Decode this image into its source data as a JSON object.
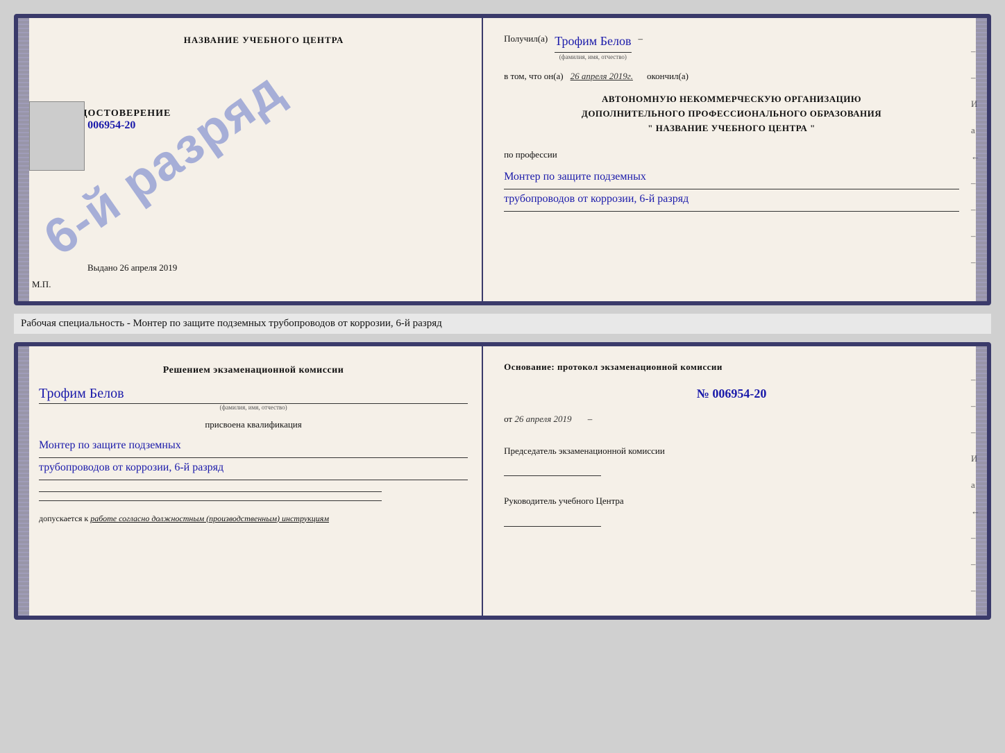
{
  "top_doc": {
    "left": {
      "center_title": "НАЗВАНИЕ УЧЕБНОГО ЦЕНТРА",
      "stamp_text": "6-й разряд",
      "udostoverenie_label": "УДОСТОВЕРЕНИЕ",
      "udost_number": "№ 006954-20",
      "vydano_prefix": "Выдано",
      "vydano_date": "26 апреля 2019",
      "mp_label": "М.П."
    },
    "right": {
      "poluchil_label": "Получил(а)",
      "handwritten_name": "Трофим Белов",
      "name_hint": "(фамилия, имя, отчество)",
      "dash1": "–",
      "vtom_label": "в том, что он(а)",
      "date_handwritten": "26 апреля 2019г.",
      "okoncil_label": "окончил(а)",
      "dash2": "–",
      "org_line1": "АВТОНОМНУЮ НЕКОММЕРЧЕСКУЮ ОРГАНИЗАЦИЮ",
      "org_line2": "ДОПОЛНИТЕЛЬНОГО ПРОФЕССИОНАЛЬНОГО ОБРАЗОВАНИЯ",
      "org_quote": "\"   НАЗВАНИЕ УЧЕБНОГО ЦЕНТРА   \"",
      "dash3": "–",
      "i_label": "И",
      "a_label": "а",
      "arrow_label": "←",
      "po_professii": "по профессии",
      "profession_line1": "Монтер по защите подземных",
      "profession_line2": "трубопроводов от коррозии, 6-й разряд",
      "dash4": "–"
    }
  },
  "middle": {
    "text": "Рабочая специальность - Монтер по защите подземных трубопроводов от коррозии, 6-й разряд"
  },
  "bottom_doc": {
    "left": {
      "title": "Решением  экзаменационной  комиссии",
      "handwritten_name": "Трофим Белов",
      "name_hint": "(фамилия, имя, отчество)",
      "prisvoena": "присвоена квалификация",
      "profession_line1": "Монтер по защите подземных",
      "profession_line2": "трубопроводов от коррозии, 6-й разряд",
      "dopuskaetsya_prefix": "допускается к",
      "dopuskaetsya_italic": "работе согласно должностным (производственным) инструкциям"
    },
    "right": {
      "title": "Основание: протокол  экзаменационной  комиссии",
      "number": "№  006954-20",
      "ot_prefix": "от",
      "ot_date": "26 апреля 2019",
      "dash1": "–",
      "dash2": "–",
      "dash3": "–",
      "i_label": "И",
      "a_label": "а",
      "arrow_label": "←",
      "predsedatel": "Председатель экзаменационной комиссии",
      "rukovoditel": "Руководитель учебного Центра",
      "dash4": "–",
      "dash5": "–",
      "dash6": "–",
      "dash7": "–",
      "dash8": "–"
    }
  }
}
